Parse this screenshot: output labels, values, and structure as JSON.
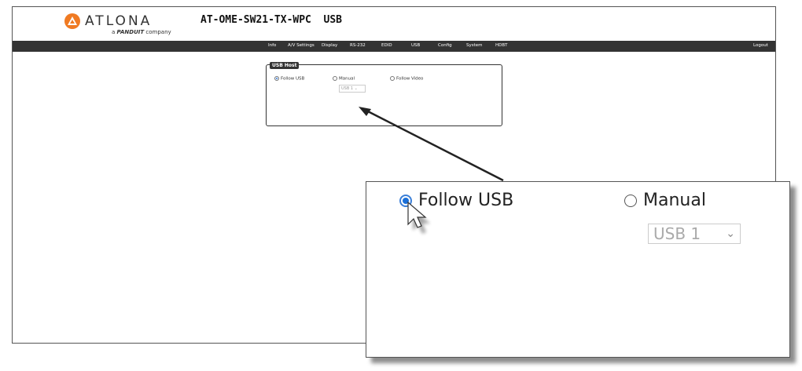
{
  "brand": {
    "name": "ATLONA",
    "tagline_prefix": "a",
    "tagline_brand": "PANDUIT",
    "tagline_suffix": "company"
  },
  "page_title": "AT-OME-SW21-TX-WPC  USB",
  "nav": {
    "items": [
      "Info",
      "A/V Settings",
      "Display",
      "RS-232",
      "EDID",
      "USB",
      "Config",
      "System",
      "HDBT"
    ],
    "logout": "Logout"
  },
  "usb_host": {
    "legend": "USB Host",
    "options": {
      "follow_usb": "Follow USB",
      "manual": "Manual",
      "follow_video": "Follow Video"
    },
    "selected": "follow_usb",
    "manual_select_value": "USB 1"
  },
  "zoom": {
    "follow_usb": "Follow USB",
    "manual": "Manual",
    "select_value": "USB 1"
  },
  "colors": {
    "navbar": "#333333",
    "radio_selected": "#1a6fd8"
  }
}
